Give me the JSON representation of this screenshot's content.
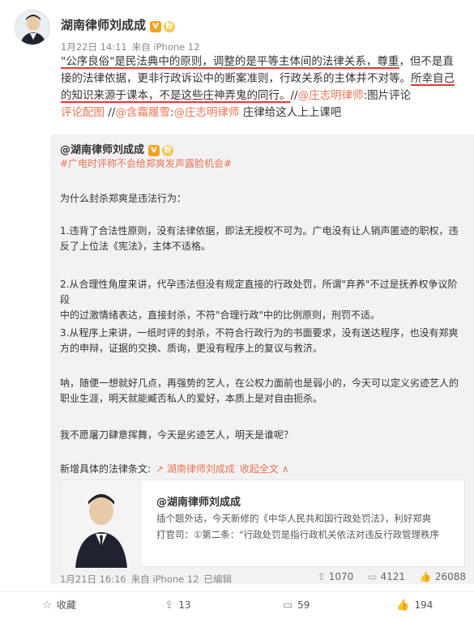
{
  "post": {
    "author": "湖南律师刘成成",
    "verified_badge": "V",
    "fan_badge": "粉",
    "time": "1月22日 14:11",
    "source": "来自 iPhone 12",
    "text": {
      "line1_hl": "\"公序良俗\"是民法典中的原则，调整的是平等主体间的法律关系，尊重",
      "line1_rest": "，但不是直",
      "line2": "接的法律依据，更非行政诉讼中的断案准则，行政关系的主体并不对等。",
      "line2_hl": "所幸自",
      "line3_hl": "己的知识来源于课本，不是这些庄神弄鬼的同行。",
      "line3_sep": "//",
      "line3_link": "@庄志明律师",
      "line3_rest": ":图片评论",
      "line4_link": "评论配图",
      "line4_sep": " //",
      "line4_link2": "@含霜履雪",
      "line4_colon": ":",
      "line4_link3": "@庄志明律师",
      "line4_rest": " 庄律给这人上上课吧"
    }
  },
  "repost": {
    "author": "@湖南律师刘成成",
    "topic": "#广电时评称不会给郑爽发声露脸机会#",
    "p1": "为什么封杀郑爽是违法行为：",
    "p2a": "1.违背了合法性原则，没有法律依据，即法无授权不可为。广电没有让人销声匿迹的职权，违",
    "p2b": "反了上位法《宪法》，主体不适格。",
    "p3a": "2.从合理性角度来讲，代孕违法但没有规定直接的行政处罚，所谓\"弃养\"不过是抚养权争议阶段",
    "p3b": "中的过激情绪表达，直接封杀，不符\"合理行政\"中的比例原则，刑罚不适。",
    "p4a": "3.从程序上来讲，一纸时评的封杀，不符合行政行为的书面要求，没有送达程序，也没有郑爽",
    "p4b": "方的申辩，证据的交换、质询，更没有程序上的复议与救济。",
    "p5a": "呐，随便一想就好几点，再强势的艺人，在公权力面前也是弱小的，今天可以定义劣迹艺人的",
    "p5b": "职业生涯，明天就能臧否私人的爱好，本质上是对自由扼杀。",
    "p6": "我不愿屠刀肆意挥舞，今天是劣迹艺人，明天是谁呢？",
    "ref_label": "新增具体的法律条文:",
    "ref_link": "↗ 湖南律师刘成成",
    "ref_collapse": "收起全文 ∧",
    "card": {
      "title": "@湖南律师刘成成",
      "desc1": "插个题外话，今天新修的《中华人民共和国行政处罚法》，利好郑爽",
      "desc2": "打官司：①第二条：\"行政处罚是指行政机关依法对违反行政管理秩序"
    },
    "time": "1月21日 16:16",
    "source": "来自 iPhone 12",
    "edited": "已编辑",
    "reposts": "1070",
    "comments": "4121",
    "likes": "26088"
  },
  "toolbar": {
    "favorite": "收藏",
    "repost": "13",
    "comment": "59",
    "like": "194"
  },
  "colors": {
    "link": "#eb7350",
    "underline": "#ee3333",
    "repost_bg": "#f2f2f5"
  }
}
